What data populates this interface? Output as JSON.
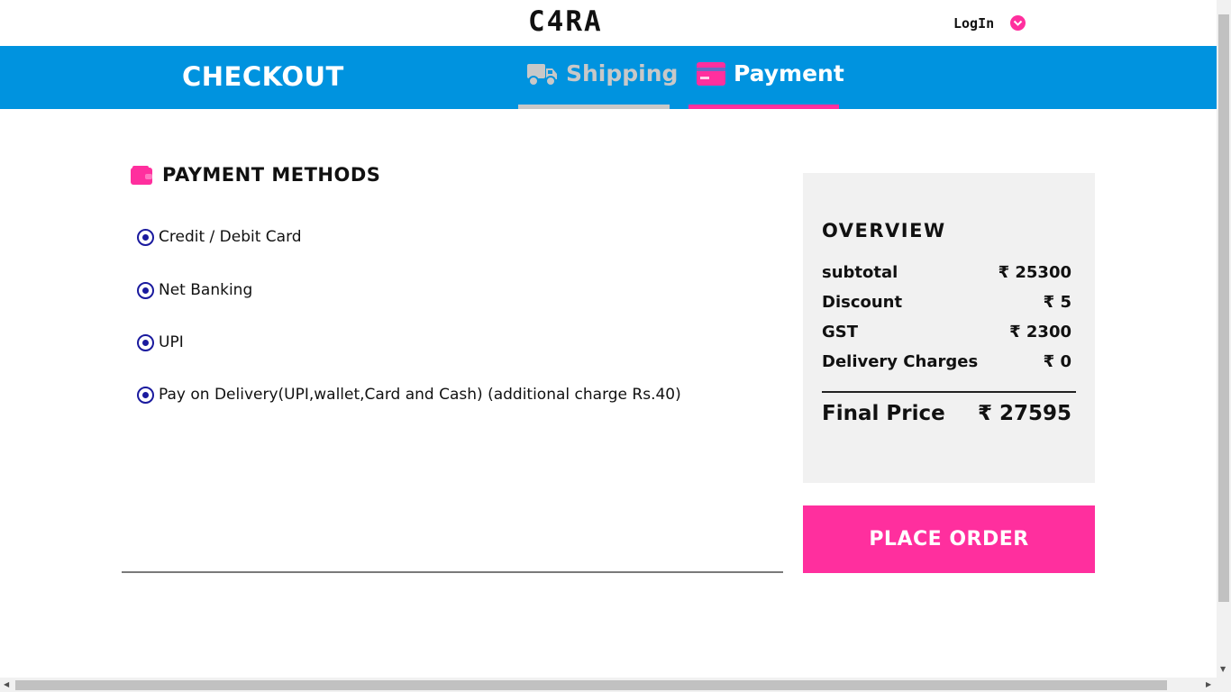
{
  "brand": {
    "logo": "C4RA"
  },
  "topbar": {
    "login_label": "LogIn"
  },
  "header": {
    "title": "CHECKOUT",
    "tabs": [
      {
        "label": "Shipping",
        "icon": "truck-icon",
        "active": false
      },
      {
        "label": "Payment",
        "icon": "credit-card-icon",
        "active": true
      }
    ]
  },
  "payment_methods": {
    "title": "PAYMENT METHODS",
    "icon": "wallet-icon",
    "options": [
      {
        "label": "Credit / Debit Card"
      },
      {
        "label": "Net Banking"
      },
      {
        "label": "UPI"
      },
      {
        "label": "Pay on Delivery(UPI,wallet,Card and Cash) (additional charge Rs.40)"
      }
    ]
  },
  "overview": {
    "title": "OVERVIEW",
    "rows": [
      {
        "label": "subtotal",
        "value": "₹ 25300"
      },
      {
        "label": "Discount",
        "value": "₹ 5"
      },
      {
        "label": "GST",
        "value": "₹ 2300"
      },
      {
        "label": "Delivery Charges",
        "value": "₹ 0"
      }
    ],
    "final": {
      "label": "Final Price",
      "value": "₹ 27595"
    }
  },
  "actions": {
    "place_order_label": "PLACE ORDER"
  },
  "colors": {
    "accent": "#ff2f9e",
    "header_bg": "#0093df",
    "radio": "#1a1a9e",
    "card_bg": "#f1f1f1"
  }
}
